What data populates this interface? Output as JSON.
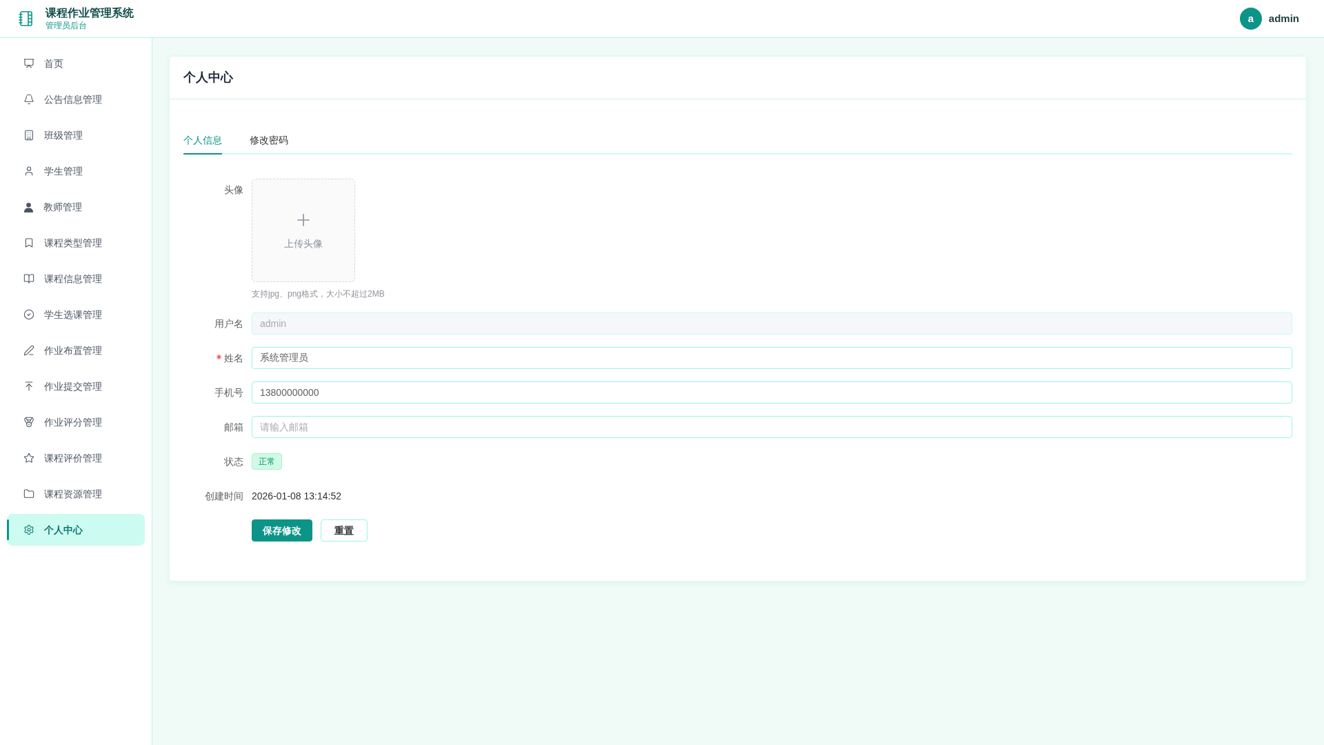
{
  "header": {
    "title": "课程作业管理系统",
    "subtitle": "管理员后台",
    "user": {
      "avatar_letter": "a",
      "name": "admin"
    }
  },
  "sidebar": {
    "items": [
      {
        "label": "首页",
        "selected": false
      },
      {
        "label": "公告信息管理",
        "selected": false
      },
      {
        "label": "班级管理",
        "selected": false
      },
      {
        "label": "学生管理",
        "selected": false
      },
      {
        "label": "教师管理",
        "selected": false
      },
      {
        "label": "课程类型管理",
        "selected": false
      },
      {
        "label": "课程信息管理",
        "selected": false
      },
      {
        "label": "学生选课管理",
        "selected": false
      },
      {
        "label": "作业布置管理",
        "selected": false
      },
      {
        "label": "作业提交管理",
        "selected": false
      },
      {
        "label": "作业评分管理",
        "selected": false
      },
      {
        "label": "课程评价管理",
        "selected": false
      },
      {
        "label": "课程资源管理",
        "selected": false
      },
      {
        "label": "个人中心",
        "selected": true
      }
    ]
  },
  "card": {
    "title": "个人中心",
    "tabs": [
      {
        "label": "个人信息",
        "selected": true
      },
      {
        "label": "修改密码",
        "selected": false
      }
    ],
    "form": {
      "fields": [
        {
          "kind": "upload",
          "label": "头像",
          "text": "上传头像",
          "hint": "支持jpg、png格式，大小不超过2MB"
        },
        {
          "kind": "input",
          "label": "用户名",
          "value": "admin",
          "disabled": true,
          "required": false
        },
        {
          "kind": "input",
          "label": "姓名",
          "value": "系统管理员",
          "disabled": false,
          "required": true
        },
        {
          "kind": "input",
          "label": "手机号",
          "value": "13800000000",
          "disabled": false,
          "required": false
        },
        {
          "kind": "input",
          "label": "邮箱",
          "placeholder": "请输入邮箱",
          "disabled": false,
          "required": false
        },
        {
          "kind": "tag",
          "label": "状态",
          "value": "正常"
        },
        {
          "kind": "text",
          "label": "创建时间",
          "value": "2026-01-08 13:14:52"
        }
      ],
      "buttons": [
        {
          "label": "保存修改",
          "kind": "primary"
        },
        {
          "label": "重置",
          "kind": "default"
        }
      ]
    }
  }
}
